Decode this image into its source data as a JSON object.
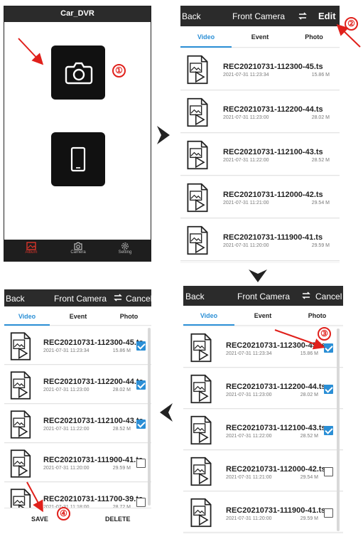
{
  "colors": {
    "accent": "#2b8fd6",
    "topbar": "#2b2b2b",
    "annotation": "#e0201b",
    "album_active": "#d8342a"
  },
  "panel_home": {
    "app_title": "Car_DVR",
    "buttons": [
      {
        "name": "camera-album-button",
        "icon": "camera-icon"
      },
      {
        "name": "phone-album-button",
        "icon": "phone-icon"
      }
    ],
    "bottom_nav": [
      {
        "label": "Album",
        "icon": "album-icon",
        "active": true
      },
      {
        "label": "Camera",
        "icon": "camera-icon",
        "active": false
      },
      {
        "label": "Setting",
        "icon": "gear-icon",
        "active": false
      }
    ],
    "step_marker": "①"
  },
  "panel_list": {
    "back_label": "Back",
    "title": "Front Camera",
    "edit_label": "Edit",
    "step_marker": "②",
    "tabs": [
      "Video",
      "Event",
      "Photo"
    ],
    "files": [
      {
        "name": "REC20210731-112300-45.ts",
        "date": "2021-07-31 11:23:34",
        "size": "15.86 M"
      },
      {
        "name": "REC20210731-112200-44.ts",
        "date": "2021-07-31 11:23:00",
        "size": "28.02 M"
      },
      {
        "name": "REC20210731-112100-43.ts",
        "date": "2021-07-31 11:22:00",
        "size": "28.52 M"
      },
      {
        "name": "REC20210731-112000-42.ts",
        "date": "2021-07-31 11:21:00",
        "size": "29.54 M"
      },
      {
        "name": "REC20210731-111900-41.ts",
        "date": "2021-07-31 11:20:00",
        "size": "29.59 M"
      }
    ]
  },
  "panel_select": {
    "back_label": "Back",
    "title": "Front Camera",
    "cancel_label": "Cancel",
    "step_marker": "③",
    "tabs": [
      "Video",
      "Event",
      "Photo"
    ],
    "files": [
      {
        "name": "REC20210731-112300-45.ts",
        "date": "2021-07-31 11:23:34",
        "size": "15.86 M",
        "checked": true
      },
      {
        "name": "REC20210731-112200-44.ts",
        "date": "2021-07-31 11:23:00",
        "size": "28.02 M",
        "checked": true
      },
      {
        "name": "REC20210731-112100-43.ts",
        "date": "2021-07-31 11:22:00",
        "size": "28.52 M",
        "checked": true
      },
      {
        "name": "REC20210731-112000-42.ts",
        "date": "2021-07-31 11:21:00",
        "size": "29.54 M",
        "checked": false
      },
      {
        "name": "REC20210731-111900-41.ts",
        "date": "2021-07-31 11:20:00",
        "size": "29.59 M",
        "checked": false
      }
    ]
  },
  "panel_save": {
    "back_label": "Back",
    "title": "Front Camera",
    "cancel_label": "Cancel",
    "step_marker": "④",
    "tabs": [
      "Video",
      "Event",
      "Photo"
    ],
    "files": [
      {
        "name": "REC20210731-112300-45.ts",
        "date": "2021-07-31 11:23:34",
        "size": "15.86 M",
        "checked": true
      },
      {
        "name": "REC20210731-112200-44.ts",
        "date": "2021-07-31 11:23:00",
        "size": "28.02 M",
        "checked": true
      },
      {
        "name": "REC20210731-112100-43.ts",
        "date": "2021-07-31 11:22:00",
        "size": "28.52 M",
        "checked": true
      },
      {
        "name": "REC20210731-111900-41.ts",
        "date": "2021-07-31 11:20:00",
        "size": "29.59 M",
        "checked": false
      },
      {
        "name": "REC20210731-111700-39.ts",
        "date": "2021-07-31 11:18:00",
        "size": "28.72 M",
        "checked": false
      }
    ],
    "save_label": "SAVE",
    "delete_label": "DELETE"
  }
}
